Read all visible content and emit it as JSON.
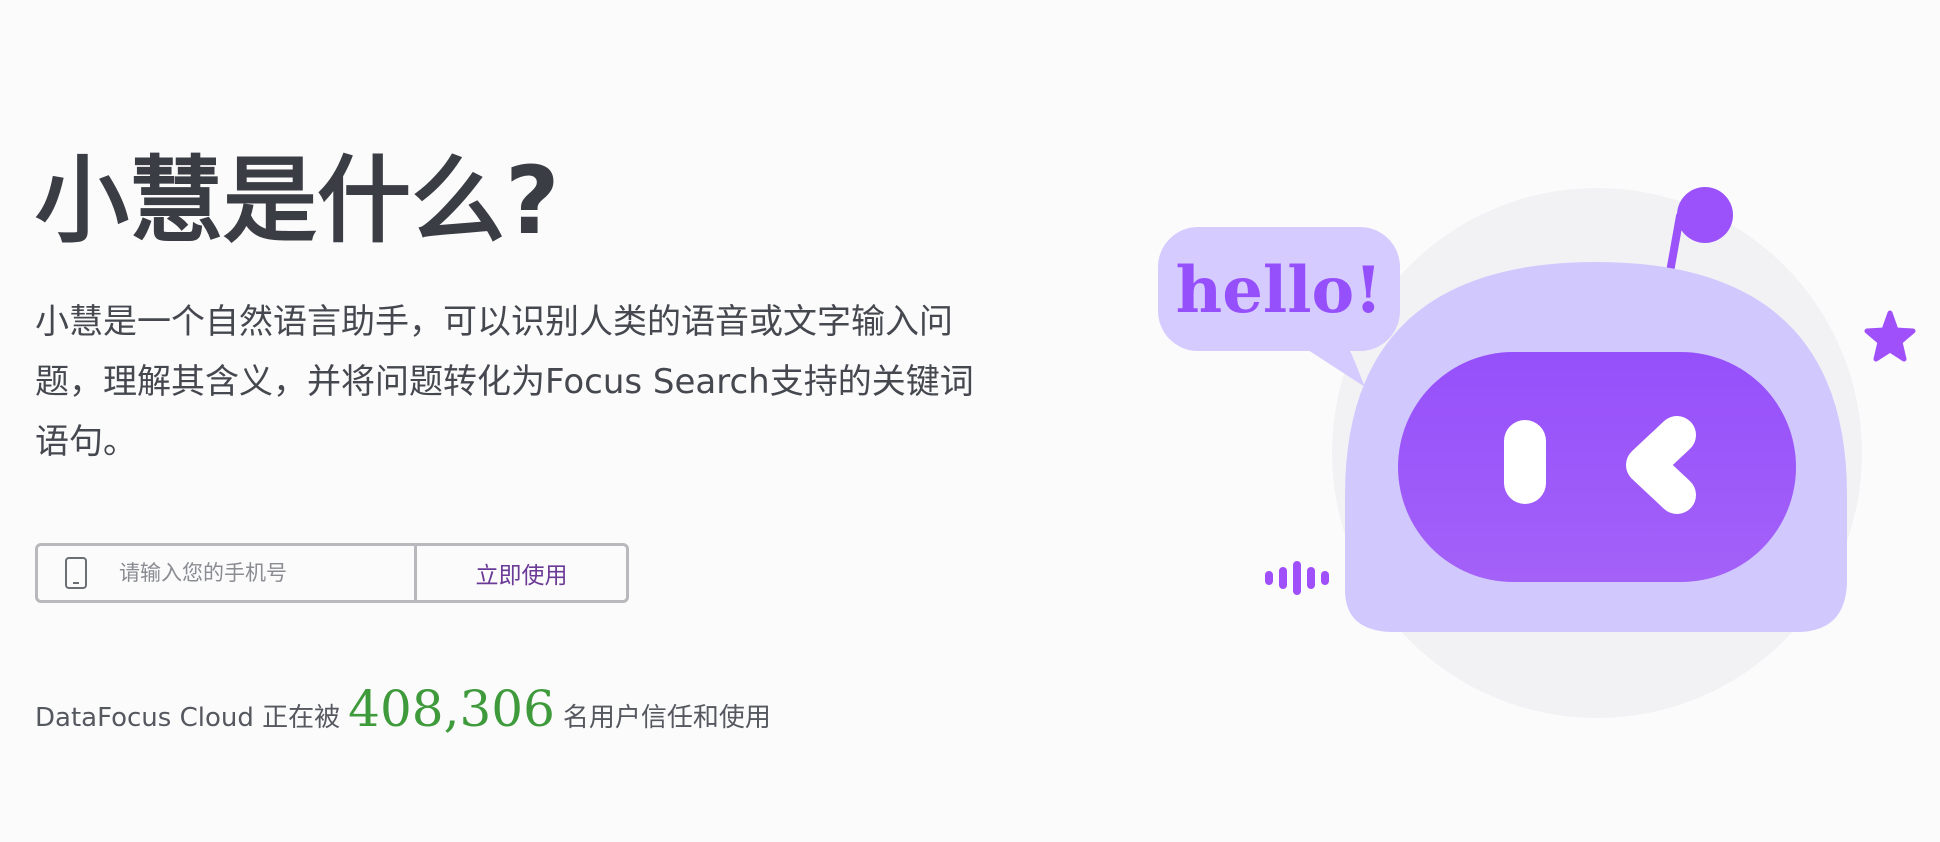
{
  "hero": {
    "title": "小慧是什么?",
    "description": "小慧是一个自然语言助手，可以识别人类的语音或文字输入问题，理解其含义，并将问题转化为Focus Search支持的关键词语句。"
  },
  "signup": {
    "phone_placeholder": "请输入您的手机号",
    "phone_value": "",
    "submit_label": "立即使用"
  },
  "trust": {
    "prefix": "DataFocus Cloud 正在被",
    "count": "408,306",
    "suffix": "名用户信任和使用"
  },
  "illustration": {
    "bubble_text": "hello!",
    "colors": {
      "primary": "#9b52fb",
      "light": "#d1c8fe",
      "bubble": "#d6cbff",
      "backdrop": "#f2f2f5"
    },
    "icons": [
      "robot-illustration",
      "speech-bubble",
      "antenna",
      "star-icon",
      "sound-wave-icon"
    ]
  }
}
